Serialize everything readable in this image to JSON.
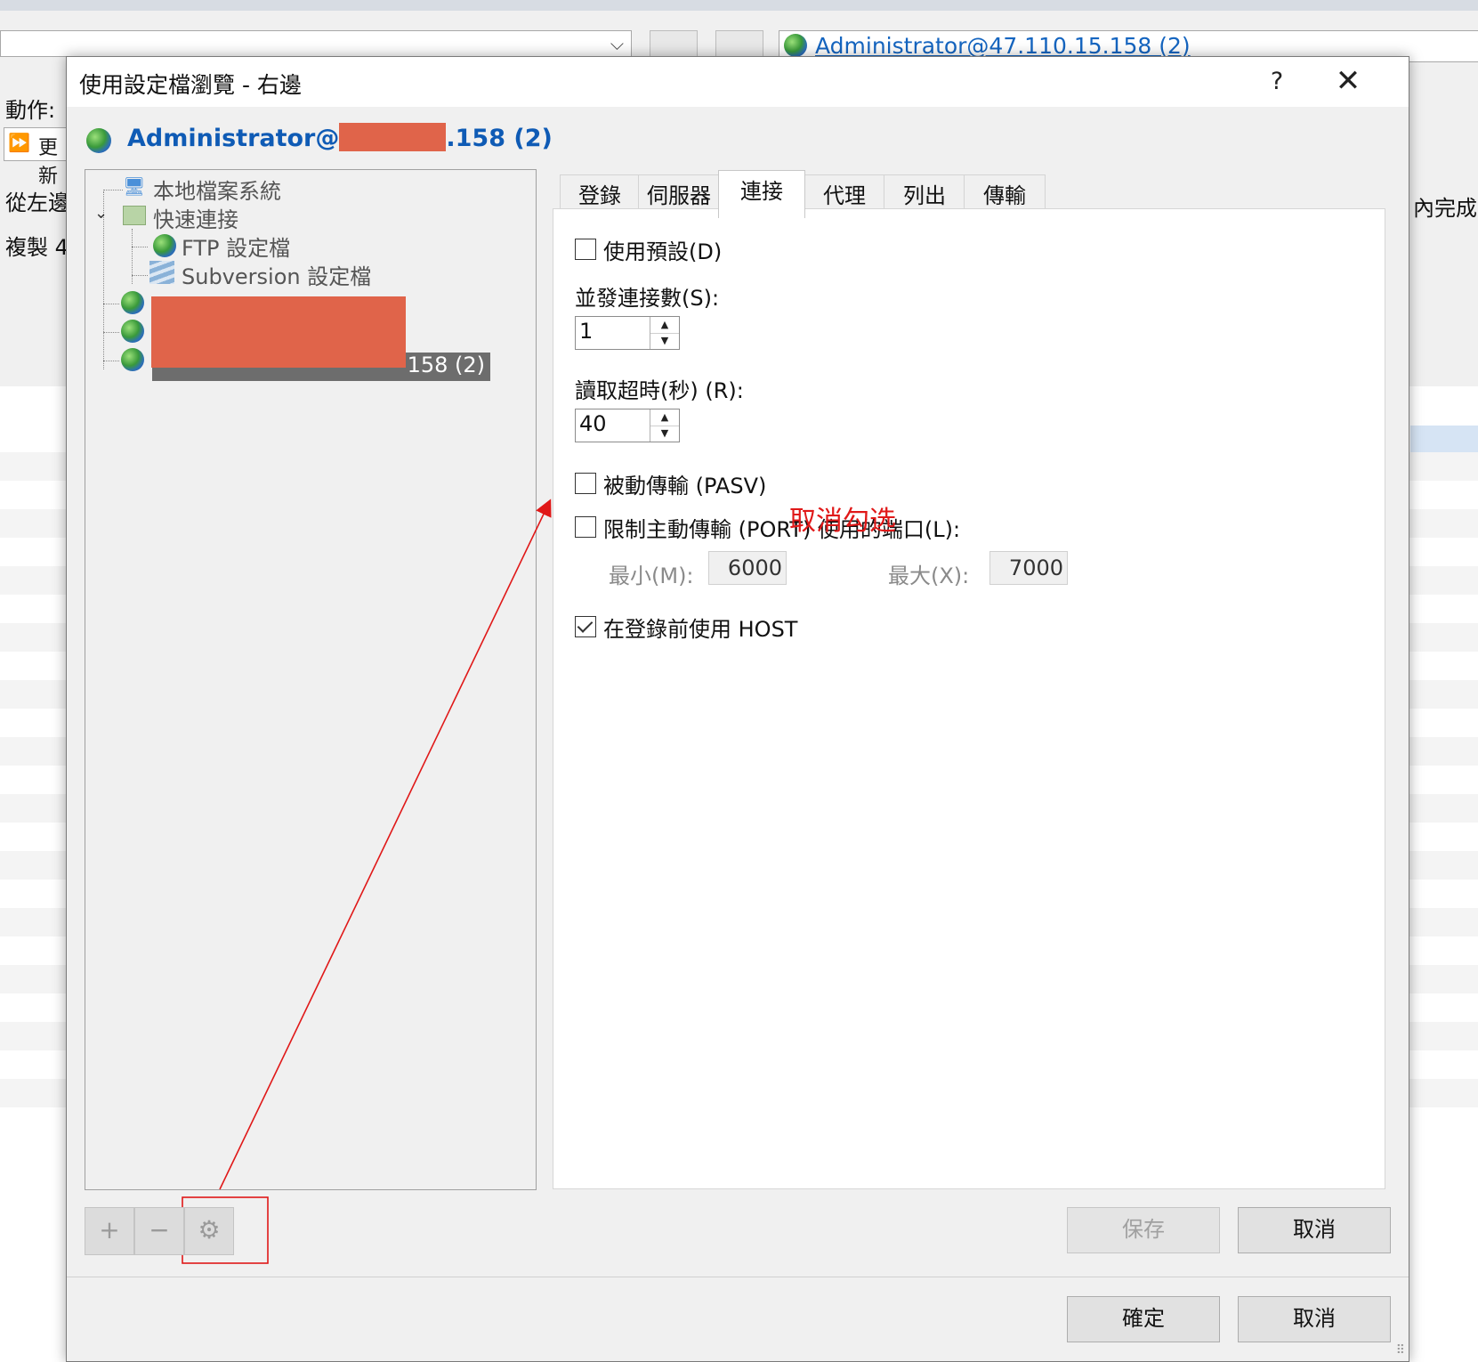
{
  "background": {
    "session_label": "Administrator@47.110.15.158 (2)",
    "action_label": "動作:",
    "update_button": "更新",
    "from_left_label": "從左邊",
    "copy_label": "複製 4",
    "done_label": "內完成"
  },
  "dialog": {
    "title": "使用設定檔瀏覽 - 右邊",
    "help": "?",
    "close": "✕",
    "header_prefix": "Administrator@",
    "header_suffix": ".158 (2)"
  },
  "tree": {
    "items": [
      {
        "label": "本地檔案系統"
      },
      {
        "label": "快速連接"
      },
      {
        "label": "FTP 設定檔"
      },
      {
        "label": "Subversion 設定檔"
      }
    ],
    "selected_suffix": "158 (2)"
  },
  "tabs": [
    "登錄",
    "伺服器",
    "連接",
    "代理",
    "列出",
    "傳輸"
  ],
  "connection": {
    "use_default": {
      "label": "使用預設(D)",
      "checked": false
    },
    "concurrent_label": "並發連接數(S):",
    "concurrent_value": "1",
    "timeout_label": "讀取超時(秒) (R):",
    "timeout_value": "40",
    "passive": {
      "label": "被動傳輸 (PASV)",
      "checked": false
    },
    "limit_port": {
      "label": "限制主動傳輸 (PORT) 使用的端口(L):",
      "checked": false
    },
    "min_label": "最小(M):",
    "min_value": "6000",
    "max_label": "最大(X):",
    "max_value": "7000",
    "host_before_login": {
      "label": "在登錄前使用 HOST",
      "checked": true
    }
  },
  "annotation": {
    "text": "取消勾选",
    "color": "#e01818"
  },
  "buttons": {
    "add": "+",
    "remove": "−",
    "settings": "⚙",
    "save": "保存",
    "cancel_inner": "取消",
    "ok": "確定",
    "cancel": "取消"
  },
  "colors": {
    "accent": "#0f5bb5",
    "redaction": "#e0644a",
    "selected_row": "#6d6d6d"
  }
}
